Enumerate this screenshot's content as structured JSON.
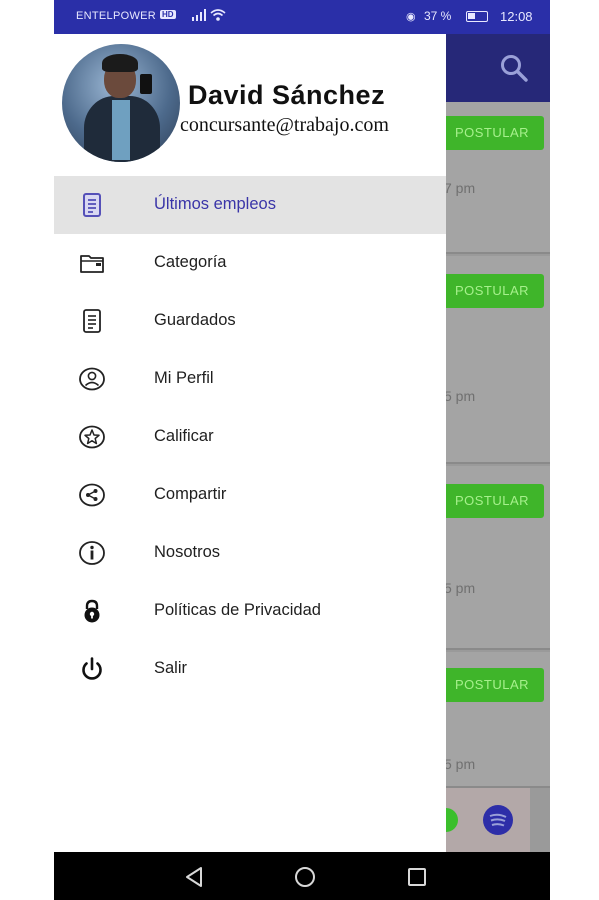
{
  "status_bar": {
    "carrier": "ENTELPOWER",
    "hd_badge": "HD",
    "battery_text": "37 %",
    "battery_level": 0.37,
    "time": "12:08"
  },
  "background": {
    "cards": [
      {
        "button_label": "POSTULAR",
        "time_fragment": "7 pm"
      },
      {
        "button_label": "POSTULAR",
        "time_fragment": "5 pm"
      },
      {
        "button_label": "POSTULAR",
        "time_fragment": "5 pm"
      },
      {
        "button_label": "POSTULAR",
        "time_fragment": "5 pm"
      }
    ]
  },
  "drawer": {
    "user_name": "David Sánchez",
    "user_email": "concursante@trabajo.com",
    "menu": [
      {
        "label": "Últimos empleos",
        "icon": "list-document-icon",
        "active": true
      },
      {
        "label": "Categoría",
        "icon": "folder-icon",
        "active": false
      },
      {
        "label": "Guardados",
        "icon": "saved-document-icon",
        "active": false
      },
      {
        "label": "Mi Perfil",
        "icon": "profile-icon",
        "active": false
      },
      {
        "label": "Calificar",
        "icon": "star-icon",
        "active": false
      },
      {
        "label": "Compartir",
        "icon": "share-icon",
        "active": false
      },
      {
        "label": "Nosotros",
        "icon": "info-icon",
        "active": false
      },
      {
        "label": "Políticas de Privacidad",
        "icon": "lock-icon",
        "active": false
      },
      {
        "label": "Salir",
        "icon": "power-icon",
        "active": false
      }
    ]
  },
  "colors": {
    "status_bar": "#2a2fa8",
    "app_bar": "#262878",
    "accent": "#3a35a8",
    "postular_button": "#3fb52a"
  }
}
